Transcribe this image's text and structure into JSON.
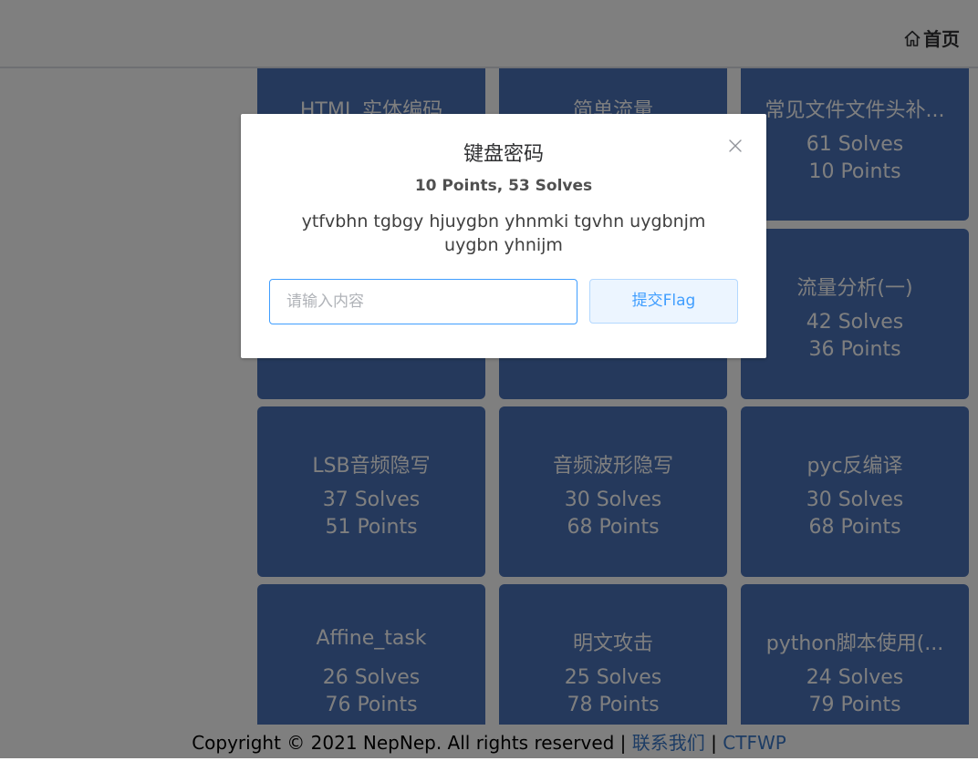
{
  "header": {
    "home_label": "首页"
  },
  "challenges": [
    {
      "name": "HTML 实体编码",
      "solves": "",
      "points": ""
    },
    {
      "name": "简单流量",
      "solves": "",
      "points": ""
    },
    {
      "name": "常见文件文件头补...",
      "solves": "61 Solves",
      "points": "10 Points"
    },
    {
      "name": "",
      "solves": "",
      "points": ""
    },
    {
      "name": "",
      "solves": "",
      "points": ""
    },
    {
      "name": "流量分析(一)",
      "solves": "42 Solves",
      "points": "36 Points"
    },
    {
      "name": "LSB音频隐写",
      "solves": "37 Solves",
      "points": "51 Points"
    },
    {
      "name": "音频波形隐写",
      "solves": "30 Solves",
      "points": "68 Points"
    },
    {
      "name": "pyc反编译",
      "solves": "30 Solves",
      "points": "68 Points"
    },
    {
      "name": "Affine_task",
      "solves": "26 Solves",
      "points": "76 Points"
    },
    {
      "name": "明文攻击",
      "solves": "25 Solves",
      "points": "78 Points"
    },
    {
      "name": "python脚本使用(...",
      "solves": "24 Solves",
      "points": "79 Points"
    }
  ],
  "footer": {
    "copyright": "Copyright © 2021 NepNep. All rights reserved |",
    "contact_label": "联系我们",
    "separator": "|",
    "ctfwp_label": "CTFWP"
  },
  "dialog": {
    "title": "键盘密码",
    "subtitle": "10 Points, 53 Solves",
    "description": "ytfvbhn tgbgy hjuygbn yhnmki tgvhn uygbnjm uygbn yhnijm",
    "input_placeholder": "请输入内容",
    "input_value": "",
    "submit_label": "提交Flag"
  },
  "colors": {
    "card_bg": "#4a72b8",
    "primary": "#409eff",
    "overlay": "rgba(0,0,0,0.5)"
  }
}
